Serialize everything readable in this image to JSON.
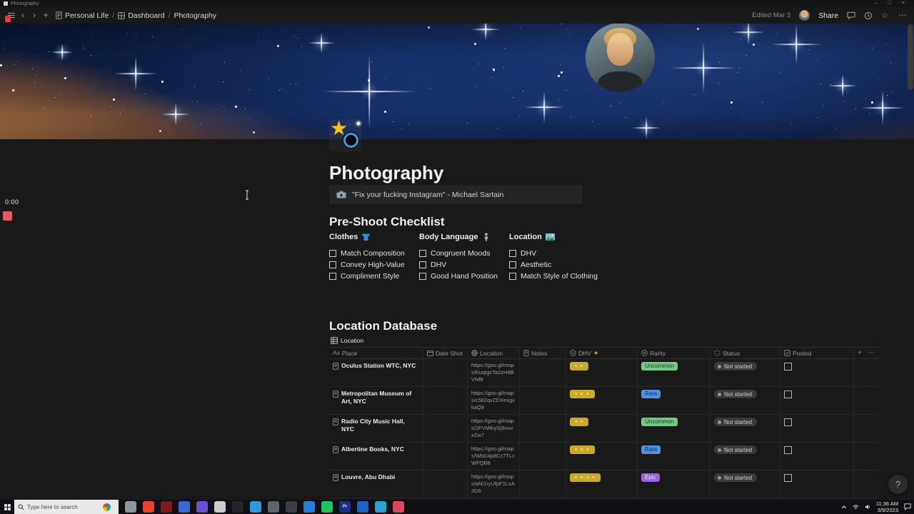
{
  "titlebar": {
    "title": "Photography",
    "minimize": "–",
    "maximize": "□",
    "close": "×"
  },
  "topbar": {
    "back": "‹",
    "forward": "›",
    "new_page": "+",
    "sep": "/",
    "breadcrumbs": [
      {
        "label": "Personal Life"
      },
      {
        "label": "Dashboard"
      },
      {
        "label": "Photography"
      }
    ],
    "edited": "Edited Mar 3",
    "share": "Share",
    "favorite": "☆",
    "more": "⋯"
  },
  "page": {
    "title": "Photography",
    "callout_text": "\"Fix your fucking Instagram\" - Michael Sartain",
    "preshoot_heading": "Pre-Shoot Checklist",
    "checklist_columns": [
      {
        "title": "Clothes",
        "items": [
          "Match Composition",
          "Convey High-Value",
          "Compliment Style"
        ]
      },
      {
        "title": "Body Language",
        "items": [
          "Congruent Moods",
          "DHV",
          "Good Hand Position"
        ]
      },
      {
        "title": "Location",
        "items": [
          "DHV",
          "Aesthetic",
          "Match Style of Clothing"
        ]
      }
    ],
    "database_heading": "Location Database",
    "view_tab_label": "Location"
  },
  "table": {
    "headers": {
      "aa": "Aa",
      "place": "Place",
      "date_shot": "Date Shot",
      "location": "Location",
      "notes": "Notes",
      "dhv": "DHV",
      "dhv_star": "★",
      "rarity": "Rarity",
      "status": "Status",
      "posted": "Posted",
      "add": "+",
      "more": "⋯"
    },
    "rows": [
      {
        "place": "Oculus Station WTC, NYC",
        "url": "https://goo.gl/maps/KuqtgcTa2zH8BVNf8",
        "stars": "★★",
        "rarity": "Uncommon",
        "rarity_color": "green",
        "status": "Not started"
      },
      {
        "place": "Metropolitan Museum of Art, NYC",
        "url": "https://goo.gl/maps/c582qvZDXexgvkaQ9",
        "stars": "★★★",
        "rarity": "Rare",
        "rarity_color": "blue",
        "status": "Not started"
      },
      {
        "place": "Radio City Music Hall, NYC",
        "url": "https://goo.gl/maps/2FVMtkySj9ouvxZw7",
        "stars": "★★",
        "rarity": "Uncommon",
        "rarity_color": "green",
        "status": "Not started"
      },
      {
        "place": "Albertine Books, NYC",
        "url": "https://goo.gl/maps/WbD4p8Cc7TLcWFQB8",
        "stars": "★★★",
        "rarity": "Rare",
        "rarity_color": "blue",
        "status": "Not started"
      },
      {
        "place": "Louvre, Abu Dhabi",
        "url": "https://goo.gl/maps/aNi1ryUfpF1LxA3D6",
        "stars": "★★★★",
        "rarity": "Epic",
        "rarity_color": "purple",
        "status": "Not started"
      }
    ]
  },
  "overlay": {
    "timer": "0:00",
    "help": "?"
  },
  "taskbar": {
    "search_placeholder": "Type here to search",
    "time": "11:36 AM",
    "date": "3/9/2023",
    "icons": [
      {
        "color": "#8f959c"
      },
      {
        "color": "#e8432e"
      },
      {
        "color": "#7e1c1c"
      },
      {
        "color": "#3b6ad4"
      },
      {
        "color": "#6a4fd0"
      },
      {
        "color": "#c8cdd4"
      },
      {
        "color": "#22262c"
      },
      {
        "color": "#2f9bd6"
      },
      {
        "color": "#5d646e"
      },
      {
        "color": "#3a3f46"
      },
      {
        "color": "#2a7fd4"
      },
      {
        "color": "#1fc45e"
      },
      {
        "color": "#1d2f7e",
        "glyph": "Pr"
      },
      {
        "color": "#1f63c4"
      },
      {
        "color": "#2aa3c8"
      },
      {
        "color": "#d84a62"
      }
    ]
  }
}
